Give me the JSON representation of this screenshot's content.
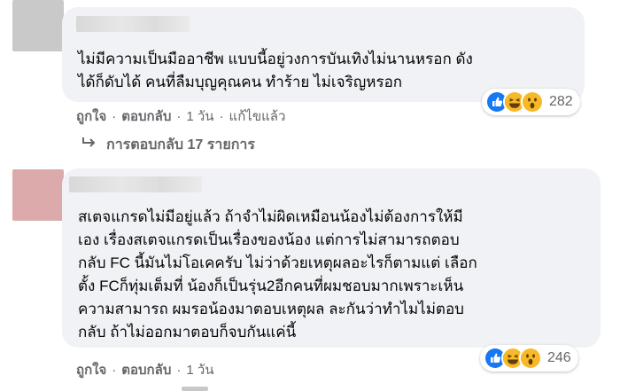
{
  "comments": [
    {
      "avatar_color": "#c9c9c9",
      "body_lines": [
        "ไม่มีความเป็นมืออาชีพ แบบนี้อยู่วงการบันเทิงไม่นานหรอก ดัง",
        "ได้ก็ดับได้ คนที่ลืมบุญคุณคน ทำร้าย ไม่เจริญหรอก"
      ],
      "reaction_count": "282",
      "actions": {
        "like": "ถูกใจ",
        "reply": "ตอบกลับ",
        "time": "1 วัน",
        "edited": "แก้ไขแล้ว"
      },
      "replies_text": "การตอบกลับ 17 รายการ"
    },
    {
      "avatar_color": "#dcaaaa",
      "body_lines": [
        "สเตจแกรดไม่มีอยู่แล้ว ถ้าจำไม่ผิดเหมือนน้องไม่ต้องการให้มี",
        "เอง เรื่องสเตจแกรดเป็นเรื่องของน้อง แต่การไม่สามารถตอบ",
        "กลับ FC นี้มันไม่โอเคครับ ไม่ว่าด้วยเหตุผลอะไรก็ตามแต่ เลือก",
        "ตั้ง FCก็ทุ่มเต็มที่ น้องก็เป็นรุ่น2อีกคนที่ผมชอบมากเพราะเห็น",
        "ความสามารถ ผมรอน้องมาตอบเหตุผล ละกันว่าทำไมไม่ตอบ",
        "กลับ ถ้าไม่ออกมาตอบก็จบกันแค่นี้"
      ],
      "reaction_count": "246",
      "actions": {
        "like": "ถูกใจ",
        "reply": "ตอบกลับ",
        "time": "1 วัน"
      }
    }
  ],
  "reaction_icons": [
    "like-icon",
    "haha-icon",
    "wow-icon"
  ],
  "colors": {
    "like_blue": "#1877f2",
    "emoji_yellow": "#f7b928",
    "bubble_bg": "#f0f2f5",
    "meta_gray": "#65676b"
  }
}
